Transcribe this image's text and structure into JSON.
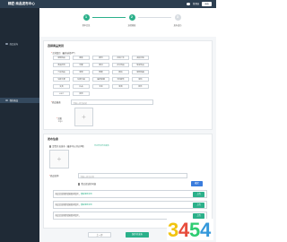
{
  "header": {
    "brand": "精匠·商品发布中心",
    "user_name": "管理员",
    "logout_label": "退出"
  },
  "sidebar": {
    "items": [
      {
        "label": "商品发布",
        "active": false
      },
      {
        "label": "我的商品",
        "active": true
      }
    ]
  },
  "steps": [
    {
      "number": "1",
      "label": "基本信息",
      "active": true
    },
    {
      "number": "2",
      "label": "选择模板",
      "active": true
    },
    {
      "number": "3",
      "label": "发布成功",
      "active": false
    }
  ],
  "category_section": {
    "title": "选择商品类别",
    "category_label": "主营类目（最多选择3个）",
    "options": [
      "家居用品",
      "服装",
      "数码",
      "运动户外",
      "美妆护肤",
      "食品饮料",
      "母婴",
      "图书",
      "办公用品",
      "珠宝饰品",
      "汽车用品",
      "宠物",
      "鞋靴",
      "箱包",
      "家用电器",
      "生鲜水果",
      "玩具乐器",
      "医药保健",
      "手机配件",
      "家纺",
      "文具",
      "礼品",
      "五金",
      "家具",
      "园艺",
      "LOFT",
      "其他"
    ],
    "description_label": "商品描述",
    "description_placeholder": "请输入商品描述",
    "logo_label": "主图",
    "logo_sub": "logo"
  },
  "publish_section": {
    "title": "发布信息",
    "option1_label": "是否开启发布（最多可以开启3项）",
    "option1_link": "不公开并开启发布",
    "option2_label": "商品名称",
    "option2_placeholder": "请输入商品名称",
    "check_label": "我已阅读并同意",
    "confirm_button": "确定",
    "row1_text": "商品信息管理请按要求填写，",
    "row1_link": "查看规则说明",
    "row1_button": "上传",
    "row2_text": "商品信息管理请按要求填写，",
    "row2_link": "查看规则说明",
    "row2_button": "上传",
    "row3_text": "商品信息管理请按要求填写，",
    "row3_button": "上传"
  },
  "footer": {
    "prev_button": "上一步",
    "next_button": "保存并发布"
  },
  "watermark_text": "3454",
  "colors": {
    "primary": "#2bb08a",
    "sidebar": "#1f2a36",
    "topbar": "#2c3e50",
    "blue": "#3b7ddd"
  }
}
